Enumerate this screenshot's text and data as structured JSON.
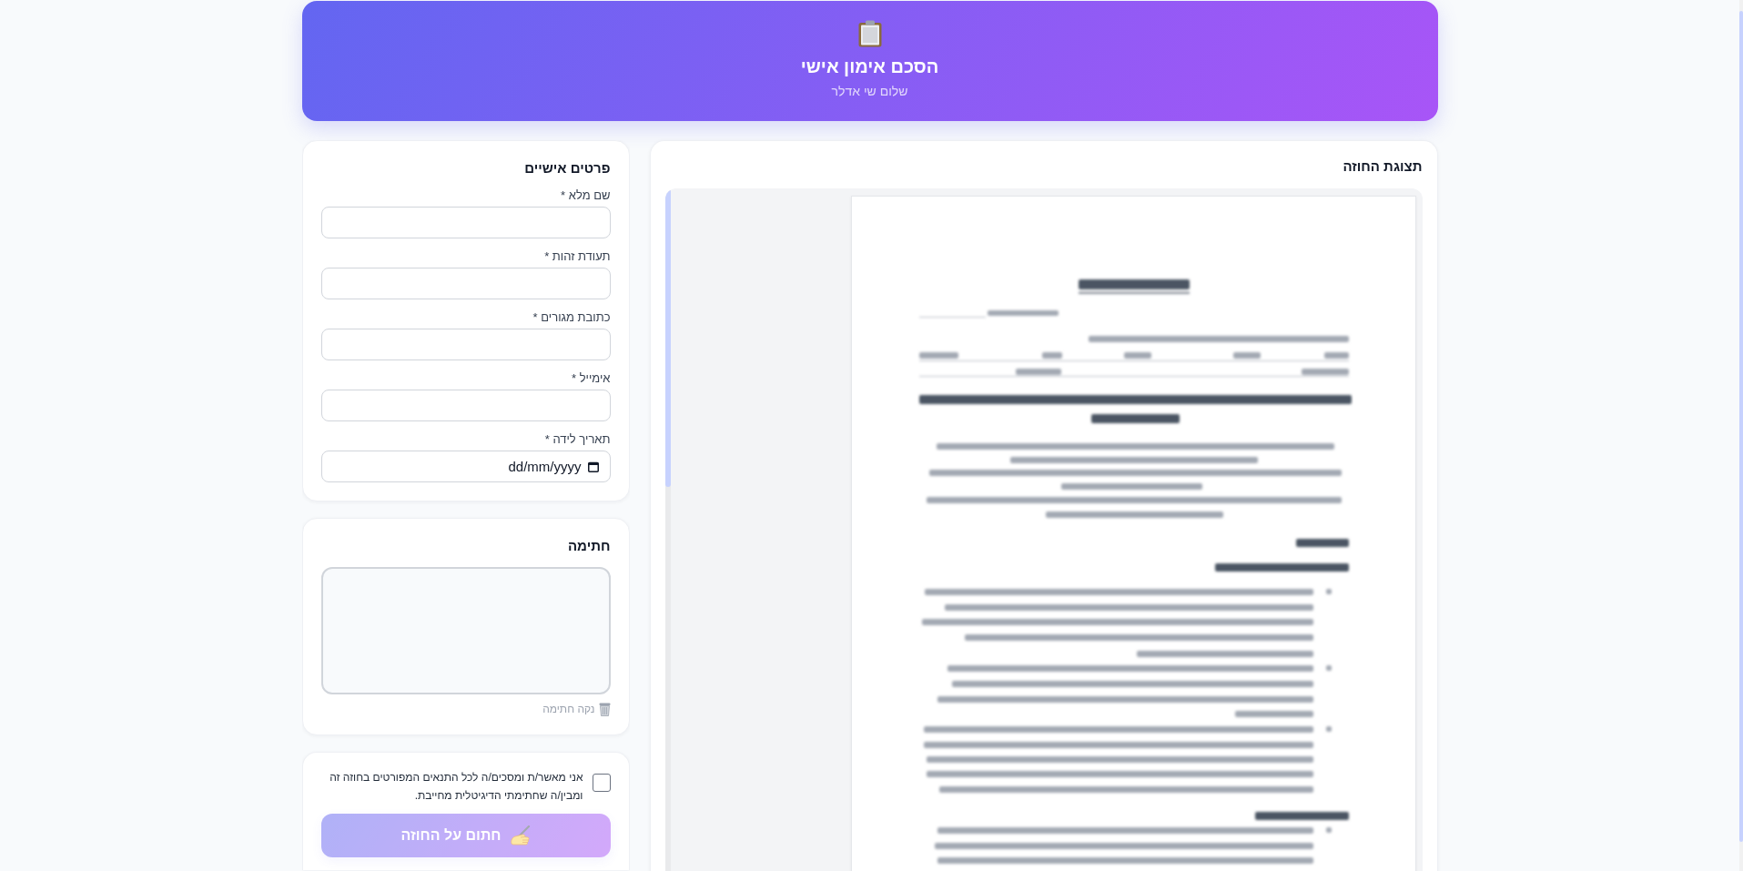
{
  "header": {
    "title": "הסכם אימון אישי",
    "subtitle": "שלום שי אדלר"
  },
  "preview": {
    "title": "תצוגת החוזה"
  },
  "personal_details": {
    "title": "פרטים אישיים",
    "fields": [
      {
        "label": "שם מלא *",
        "kind": "text"
      },
      {
        "label": "תעודת זהות *",
        "kind": "text"
      },
      {
        "label": "כתובת מגורים *",
        "kind": "text"
      },
      {
        "label": "אימייל *",
        "kind": "text"
      },
      {
        "label": "תאריך לידה *",
        "kind": "date",
        "placeholder": "dd/mm/yyyy"
      }
    ]
  },
  "signature": {
    "title": "חתימה",
    "clear_button": "נקה חתימה"
  },
  "consent": {
    "checked": false,
    "label": "אני מאשר/ת ומסכים/ה לכל התנאים המפורטים בחוזה זה ומבין/ה שחתימתי הדיגיטלית מחייבת.",
    "submit_button": {
      "label": "חתום על החוזה",
      "disabled": true
    }
  }
}
